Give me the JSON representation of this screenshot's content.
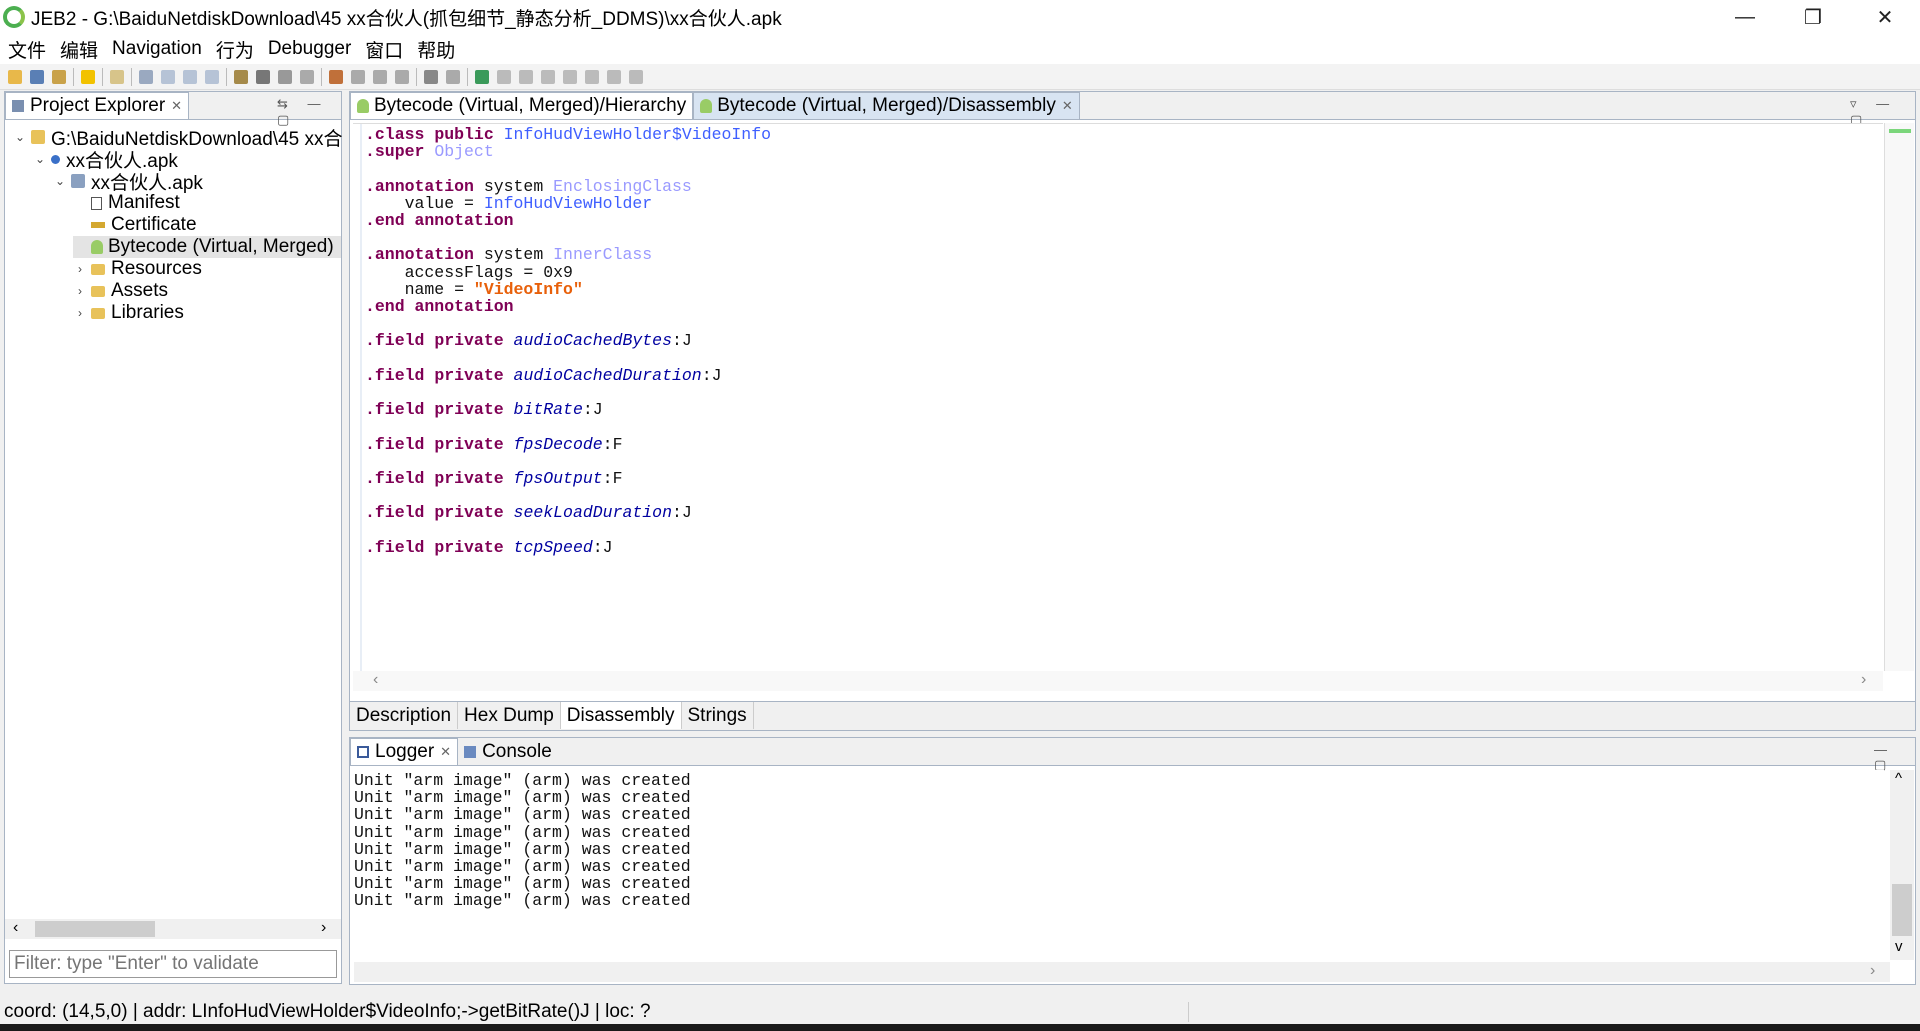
{
  "window": {
    "title": "JEB2 - G:\\BaiduNetdiskDownload\\45 xx合伙人(抓包细节_静态分析_DDMS)\\xx合伙人.apk",
    "minimize": "—",
    "restore": "❐",
    "close": "✕"
  },
  "menu": [
    "文件",
    "编辑",
    "Navigation",
    "行为",
    "Debugger",
    "窗口",
    "帮助"
  ],
  "project_explorer": {
    "tab_label": "Project Explorer",
    "tree": [
      {
        "label": "G:\\BaiduNetdiskDownload\\45 xx合",
        "icon": "folder-open-icon",
        "arrow": "⌄"
      },
      {
        "label": "xx合伙人.apk",
        "icon": "apk-icon",
        "arrow": "⌄"
      },
      {
        "label": "xx合伙人.apk",
        "icon": "package-icon",
        "arrow": "⌄"
      },
      {
        "label": "Manifest",
        "icon": "manifest-icon",
        "arrow": ""
      },
      {
        "label": "Certificate",
        "icon": "key-icon",
        "arrow": ""
      },
      {
        "label": "Bytecode (Virtual, Merged)",
        "icon": "android-icon",
        "arrow": ""
      },
      {
        "label": "Resources",
        "icon": "folder-icon",
        "arrow": "›"
      },
      {
        "label": "Assets",
        "icon": "folder-icon",
        "arrow": "›"
      },
      {
        "label": "Libraries",
        "icon": "folder-icon",
        "arrow": "›"
      }
    ],
    "filter_placeholder": "Filter: type \"Enter\" to validate"
  },
  "editor": {
    "tabs": [
      "Bytecode (Virtual, Merged)/Hierarchy",
      "Bytecode (Virtual, Merged)/Disassembly"
    ],
    "bottom_tabs": [
      "Description",
      "Hex Dump",
      "Disassembly",
      "Strings"
    ],
    "code": {
      "class_kw": ".class",
      "public_kw": "public",
      "class_name": "InfoHudViewHolder$VideoInfo",
      "super_kw": ".super",
      "super_name": "Object",
      "annotation_kw": ".annotation",
      "system": "system",
      "enclosing": "EnclosingClass",
      "value_line": "    value = ",
      "enclosing_value": "InfoHudViewHolder",
      "end_annotation": ".end annotation",
      "inner": "InnerClass",
      "access_line": "    accessFlags = 0x9",
      "name_line": "    name = ",
      "name_value": "\"VideoInfo\"",
      "field_kw": ".field",
      "private_kw": "private",
      "fields": [
        {
          "name": "audioCachedBytes",
          "type": ":J"
        },
        {
          "name": "audioCachedDuration",
          "type": ":J"
        },
        {
          "name": "bitRate",
          "type": ":J"
        },
        {
          "name": "fpsDecode",
          "type": ":F"
        },
        {
          "name": "fpsOutput",
          "type": ":F"
        },
        {
          "name": "seekLoadDuration",
          "type": ":J"
        },
        {
          "name": "tcpSpeed",
          "type": ":J"
        }
      ]
    }
  },
  "bottom_panel": {
    "tabs": [
      "Logger",
      "Console"
    ],
    "log_lines": [
      "Unit \"arm image\" (arm) was created",
      "Unit \"arm image\" (arm) was created",
      "Unit \"arm image\" (arm) was created",
      "Unit \"arm image\" (arm) was created",
      "Unit \"arm image\" (arm) was created",
      "Unit \"arm image\" (arm) was created",
      "Unit \"arm image\" (arm) was created",
      "Unit \"arm image\" (arm) was created"
    ]
  },
  "status": {
    "text": "coord: (14,5,0) | addr: LInfoHudViewHolder$VideoInfo;->getBitRate()J | loc: ?"
  }
}
